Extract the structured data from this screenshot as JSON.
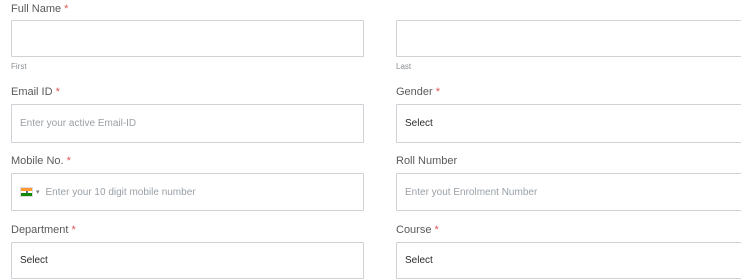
{
  "full_name": {
    "label": "Full Name",
    "required_mark": "*",
    "first_sublabel": "First",
    "last_sublabel": "Last",
    "first_value": "",
    "last_value": ""
  },
  "email": {
    "label": "Email ID",
    "required_mark": "*",
    "placeholder": "Enter your active Email-ID"
  },
  "gender": {
    "label": "Gender",
    "required_mark": "*",
    "selected": "Select"
  },
  "mobile": {
    "label": "Mobile No.",
    "required_mark": "*",
    "country_icon": "india-flag-icon",
    "dropdown_icon": "chevron-down-icon",
    "placeholder": "Enter your 10 digit mobile number"
  },
  "roll_number": {
    "label": "Roll Number",
    "placeholder": "Enter yout Enrolment Number"
  },
  "department": {
    "label": "Department",
    "required_mark": "*",
    "selected": "Select"
  },
  "course": {
    "label": "Course",
    "required_mark": "*",
    "selected": "Select"
  },
  "colors": {
    "required": "#e05555",
    "border": "#cfd3d8",
    "label_text": "#5a5a5a",
    "placeholder": "#9aa0a6"
  }
}
